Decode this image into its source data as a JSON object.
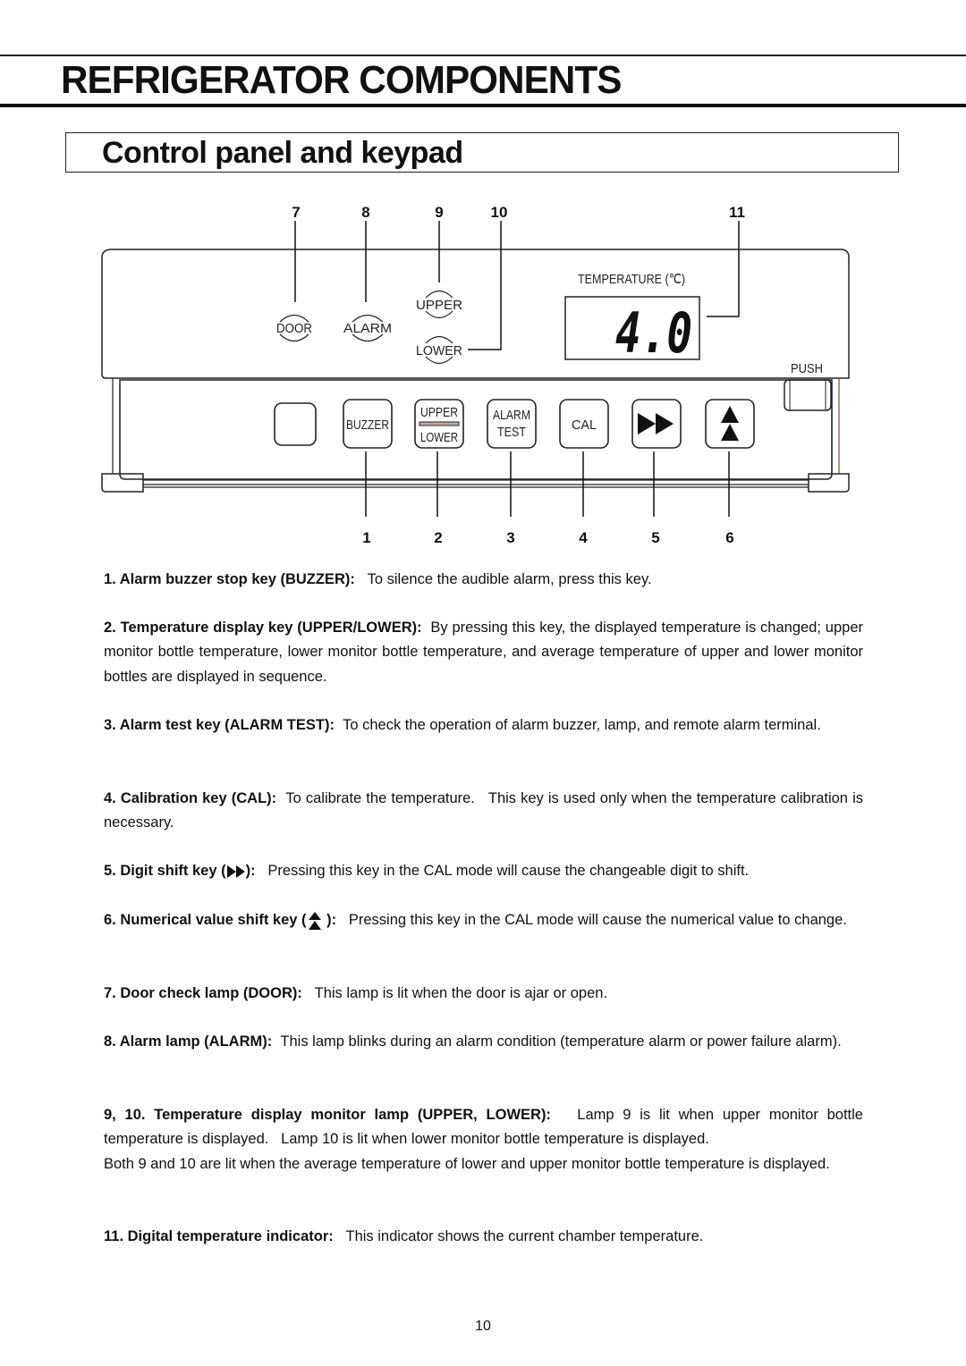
{
  "page": {
    "title": "REFRIGERATOR COMPONENTS",
    "section_title": "Control panel and keypad",
    "page_number": "10"
  },
  "diagram": {
    "top_callouts": [
      "7",
      "8",
      "9",
      "10",
      "11"
    ],
    "bottom_callouts": [
      "1",
      "2",
      "3",
      "4",
      "5",
      "6"
    ],
    "lamps": {
      "door": "DOOR",
      "alarm": "ALARM",
      "upper": "UPPER",
      "lower": "LOWER"
    },
    "display": {
      "label": "TEMPERATURE (℃)",
      "value": "4.0"
    },
    "push_label": "PUSH",
    "keys": {
      "buzzer": "BUZZER",
      "upper": "UPPER",
      "lower": "LOWER",
      "alarm": "ALARM",
      "test": "TEST",
      "cal": "CAL"
    }
  },
  "descriptions": [
    {
      "term": "1. Alarm buzzer stop key (BUZZER):",
      "text": "To silence the audible alarm, press this key."
    },
    {
      "term": "2. Temperature display key (UPPER/LOWER):",
      "text": "By pressing this key, the displayed temperature is changed; upper monitor bottle temperature, lower monitor bottle temperature, and average temperature of upper and lower monitor bottles are displayed in sequence."
    },
    {
      "term": "3. Alarm test key (ALARM TEST):",
      "text": "To check the operation of alarm buzzer, lamp, and remote alarm terminal."
    },
    {
      "term": "4. Calibration key (CAL):",
      "text": "To calibrate the temperature.   This key is used only when the temperature calibration is necessary."
    },
    {
      "term_prefix": "5. Digit shift key (",
      "term_suffix": "):",
      "icon": "double-right-triangle-icon",
      "text": "Pressing this key in the CAL mode will cause the changeable digit to shift."
    },
    {
      "term_prefix": "6. Numerical value shift key (",
      "term_suffix": " ):",
      "icon": "double-up-triangle-icon",
      "text": "Pressing this key in the CAL mode will cause the numerical value to change."
    },
    {
      "term": "7. Door check lamp (DOOR):",
      "text": "This lamp is lit when the door is ajar or open."
    },
    {
      "term": "8. Alarm lamp (ALARM):",
      "text": "This lamp blinks during an alarm condition (temperature alarm or power failure alarm)."
    },
    {
      "term": "9, 10. Temperature display monitor lamp (UPPER, LOWER):",
      "text": "Lamp 9 is lit when upper monitor bottle temperature is displayed.   Lamp 10 is lit when lower monitor bottle temperature is displayed.",
      "text2": "Both 9 and 10 are lit when the average temperature of lower and upper monitor bottle temperature is displayed."
    },
    {
      "term": "11. Digital temperature indicator:",
      "text": "This indicator shows the current chamber temperature."
    }
  ]
}
